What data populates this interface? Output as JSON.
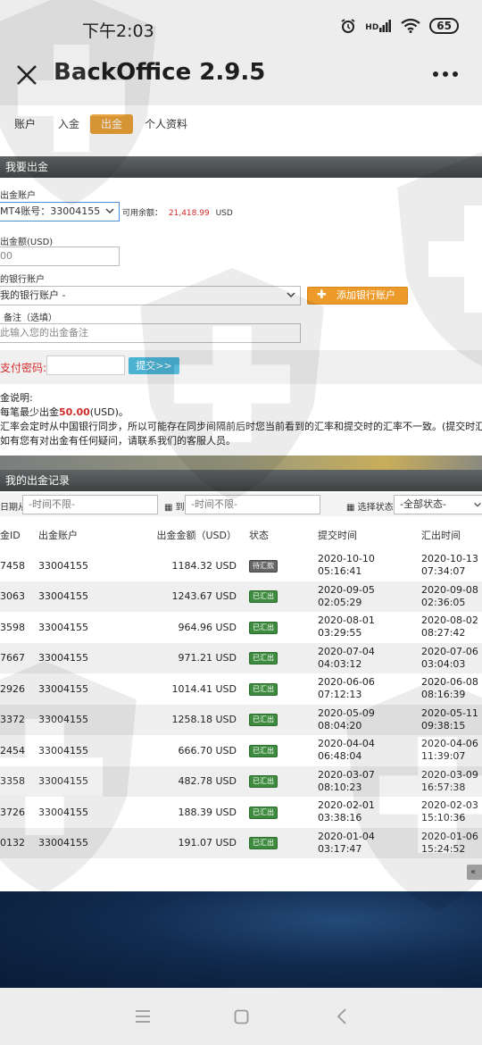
{
  "status": {
    "time": "下午2:03",
    "hd": "HD",
    "battery": "65"
  },
  "app": {
    "title": "BackOffice 2.9.5"
  },
  "tabs": [
    "账户",
    "入金",
    "出金",
    "个人资料"
  ],
  "withdraw_section": {
    "title": "我要出金"
  },
  "form": {
    "account_label": "出金账户",
    "account_value": "MT4账号：33004155",
    "balance_label": "可用余额：",
    "balance_value": "21,418.99",
    "balance_unit": "USD",
    "amount_label": "出金额(USD)",
    "amount_value": "00",
    "bank_label": "的银行账户",
    "bank_value": "我的银行账户 -",
    "add_bank_label": "添加银行账户",
    "memo_label": "备注（选填）",
    "memo_placeholder": "此输入您的出金备注",
    "pay_password_label": "支付密码:",
    "submit_label": "提交>>"
  },
  "notes": {
    "title": "金说明:",
    "line1_prefix": "每笔最少出金",
    "line1_amount": "50.00",
    "line1_suffix": "(USD)。",
    "line2": "汇率会定时从中国银行同步，所以可能存在同步间隔前后时您当前看到的汇率和提交时的汇率不一致。(提交时汇",
    "line3": "如有您有对出金有任何疑问，请联系我们的客服人员。"
  },
  "records_section": {
    "title": "我的出金记录"
  },
  "filters": {
    "from_label": "日期从",
    "from_placeholder": "-时间不限-",
    "to_label": "到",
    "to_placeholder": "-时间不限-",
    "status_label": "选择状态",
    "status_value": "-全部状态-"
  },
  "table": {
    "headers": [
      "金ID",
      "出金账户",
      "出金金额（USD）",
      "状态",
      "提交时间",
      "汇出时间"
    ],
    "rows": [
      {
        "id": "7458",
        "account": "33004155",
        "amount": "1184.32 USD",
        "status": "待汇款",
        "status_type": "wait",
        "submit_date": "2020-10-10",
        "submit_time": "05:16:41",
        "remit_date": "2020-10-13",
        "remit_time": "07:34:07"
      },
      {
        "id": "3063",
        "account": "33004155",
        "amount": "1243.67 USD",
        "status": "已汇出",
        "status_type": "done",
        "submit_date": "2020-09-05",
        "submit_time": "02:05:29",
        "remit_date": "2020-09-08",
        "remit_time": "02:36:05"
      },
      {
        "id": "3598",
        "account": "33004155",
        "amount": "964.96 USD",
        "status": "已汇出",
        "status_type": "done",
        "submit_date": "2020-08-01",
        "submit_time": "03:29:55",
        "remit_date": "2020-08-02",
        "remit_time": "08:27:42"
      },
      {
        "id": "7667",
        "account": "33004155",
        "amount": "971.21 USD",
        "status": "已汇出",
        "status_type": "done",
        "submit_date": "2020-07-04",
        "submit_time": "04:03:12",
        "remit_date": "2020-07-06",
        "remit_time": "03:04:03"
      },
      {
        "id": "2926",
        "account": "33004155",
        "amount": "1014.41 USD",
        "status": "已汇出",
        "status_type": "done",
        "submit_date": "2020-06-06",
        "submit_time": "07:12:13",
        "remit_date": "2020-06-08",
        "remit_time": "08:16:39"
      },
      {
        "id": "3372",
        "account": "33004155",
        "amount": "1258.18 USD",
        "status": "已汇出",
        "status_type": "done",
        "submit_date": "2020-05-09",
        "submit_time": "08:04:20",
        "remit_date": "2020-05-11",
        "remit_time": "09:38:15"
      },
      {
        "id": "2454",
        "account": "33004155",
        "amount": "666.70 USD",
        "status": "已汇出",
        "status_type": "done",
        "submit_date": "2020-04-04",
        "submit_time": "06:48:04",
        "remit_date": "2020-04-06",
        "remit_time": "11:39:07"
      },
      {
        "id": "3358",
        "account": "33004155",
        "amount": "482.78 USD",
        "status": "已汇出",
        "status_type": "done",
        "submit_date": "2020-03-07",
        "submit_time": "08:10:23",
        "remit_date": "2020-03-09",
        "remit_time": "16:57:38"
      },
      {
        "id": "3726",
        "account": "33004155",
        "amount": "188.39 USD",
        "status": "已汇出",
        "status_type": "done",
        "submit_date": "2020-02-01",
        "submit_time": "03:38:16",
        "remit_date": "2020-02-03",
        "remit_time": "15:10:36"
      },
      {
        "id": "0132",
        "account": "33004155",
        "amount": "191.07 USD",
        "status": "已汇出",
        "status_type": "done",
        "submit_date": "2020-01-04",
        "submit_time": "03:17:47",
        "remit_date": "2020-01-06",
        "remit_time": "15:24:52"
      }
    ]
  },
  "pager": {
    "label": "«"
  },
  "colors": {
    "accent": "#e8a038",
    "section_header": "#4a4e4e",
    "amount_green": "#2a8a2a",
    "status_done": "#3e8a3e",
    "warning_red": "#d02a2a"
  },
  "icons": {
    "close": "close-icon",
    "more": "more-icon",
    "menu": "menu-icon",
    "home": "home-icon",
    "back": "back-icon"
  }
}
